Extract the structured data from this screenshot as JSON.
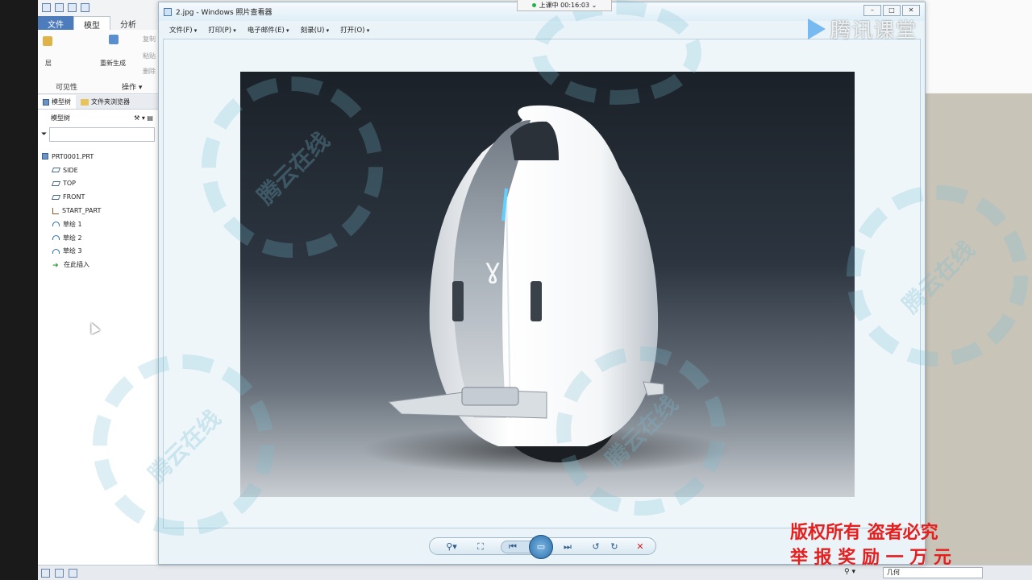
{
  "cad": {
    "tabs": [
      "文件",
      "模型",
      "分析"
    ],
    "ribbon": {
      "layer_label": "层",
      "regenerate_label": "重新生成",
      "copy_label": "复制",
      "paste_label": "粘贴",
      "delete_label": "删除",
      "group_visibility": "可见性",
      "group_operations": "操作 ▾"
    },
    "tree_tabs": [
      "模型树",
      "文件夹浏览器"
    ],
    "tree_title": "模型树",
    "tree_items": [
      {
        "label": "PRT0001.PRT",
        "icon": "part-icon"
      },
      {
        "label": "SIDE",
        "icon": "datum-plane-icon"
      },
      {
        "label": "TOP",
        "icon": "datum-plane-icon"
      },
      {
        "label": "FRONT",
        "icon": "datum-plane-icon"
      },
      {
        "label": "START_PART",
        "icon": "coordinate-system-icon"
      },
      {
        "label": "草绘 1",
        "icon": "sketch-icon"
      },
      {
        "label": "草绘 2",
        "icon": "sketch-icon"
      },
      {
        "label": "草绘 3",
        "icon": "sketch-icon"
      },
      {
        "label": "在此插入",
        "icon": "insert-here-icon"
      }
    ],
    "status_select": "几何"
  },
  "viewer": {
    "title": "2.jpg - Windows 照片查看器",
    "menu": [
      "文件(F)",
      "打印(P)",
      "电子邮件(E)",
      "刻录(U)",
      "打开(O)"
    ],
    "photo_logo": "ɣ"
  },
  "timer": "上课中 00:16:03 ⌄",
  "brand": "腾讯课堂",
  "watermark": "腾云在线",
  "copyright": [
    "版权所有 盗者必究",
    "举 报 奖 励 一 万 元"
  ],
  "colors": {
    "accent": "#4d7cbd",
    "copyright": "#e51e1e",
    "timer_dot": "#21b24b"
  }
}
